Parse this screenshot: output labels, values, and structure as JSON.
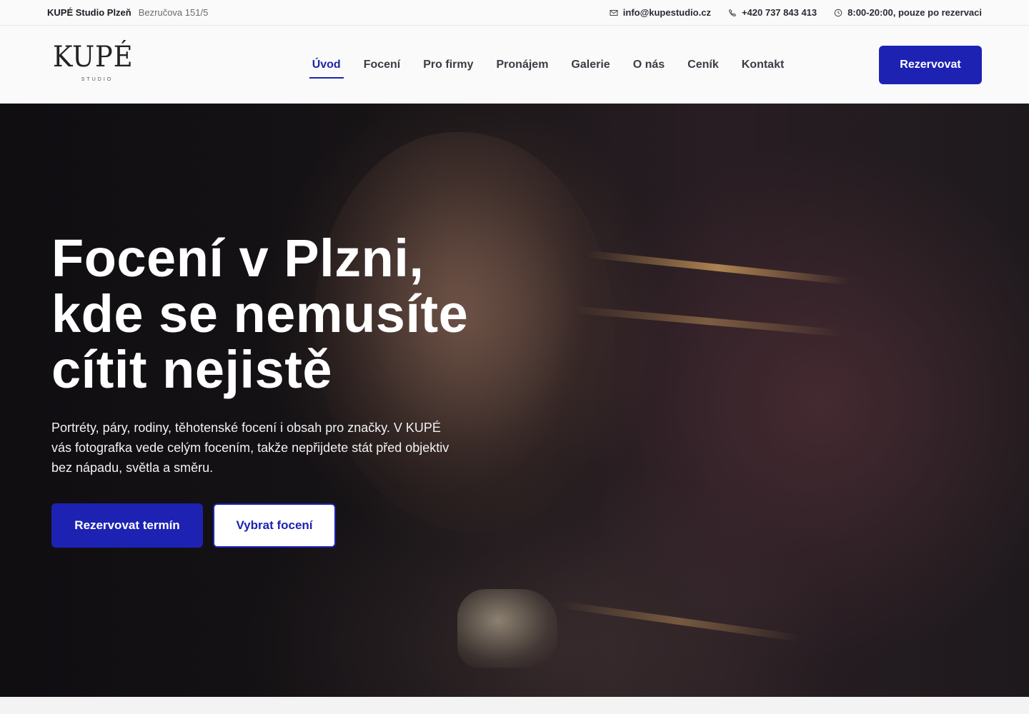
{
  "topbar": {
    "brand": "KUPÉ Studio Plzeň",
    "address": "Bezručova 151/5",
    "email": "info@kupestudio.cz",
    "phone": "+420 737 843 413",
    "hours": "8:00-20:00, pouze po rezervaci",
    "icons": [
      "mail-icon",
      "phone-icon",
      "clock-icon"
    ]
  },
  "header": {
    "logo": {
      "wordmark": "KUPÉ",
      "sub": "STUDIO"
    },
    "nav": [
      {
        "label": "Úvod",
        "active": true
      },
      {
        "label": "Focení",
        "active": false
      },
      {
        "label": "Pro firmy",
        "active": false
      },
      {
        "label": "Pronájem",
        "active": false
      },
      {
        "label": "Galerie",
        "active": false
      },
      {
        "label": "O nás",
        "active": false
      },
      {
        "label": "Ceník",
        "active": false
      },
      {
        "label": "Kontakt",
        "active": false
      }
    ],
    "cta": "Rezervovat"
  },
  "hero": {
    "title_lines": [
      "Focení v Plzni,",
      "kde se nemusíte",
      "cítit nejistě"
    ],
    "text": "Portréty, páry, rodiny, těhotenské focení i obsah pro značky. V KUPÉ vás fotografka vede celým focením, takže nepřijdete stát před objektiv bez nápadu, světla a směru.",
    "primary_button": "Rezervovat termín",
    "secondary_button": "Vybrat focení"
  },
  "colors": {
    "accent": "#1d22b3",
    "nav_active": "#1f24a8",
    "topbar_bg": "#fafafa"
  }
}
